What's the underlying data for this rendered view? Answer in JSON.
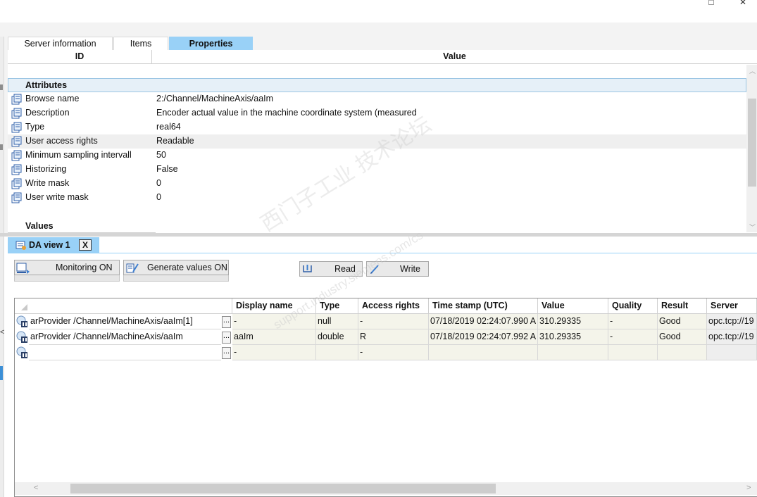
{
  "window": {
    "minimize_glyph": "□",
    "close_glyph": "✕"
  },
  "tabs": [
    {
      "label": "Server information",
      "active": false
    },
    {
      "label": "Items",
      "active": false
    },
    {
      "label": "Properties",
      "active": true
    }
  ],
  "properties": {
    "columns": {
      "id": "ID",
      "value": "Value"
    },
    "group_attributes": "Attributes",
    "rows": [
      {
        "id": "Browse name",
        "value": "2:/Channel/MachineAxis/aaIm",
        "highlighted": false
      },
      {
        "id": "Description",
        "value": "Encoder actual value in the machine coordinate system (measured",
        "highlighted": false
      },
      {
        "id": "Type",
        "value": "real64",
        "highlighted": false
      },
      {
        "id": "User access rights",
        "value": "Readable",
        "highlighted": true
      },
      {
        "id": "Minimum sampling intervall",
        "value": "50",
        "highlighted": false
      },
      {
        "id": "Historizing",
        "value": "False",
        "highlighted": false
      },
      {
        "id": "Write mask",
        "value": "0",
        "highlighted": false
      },
      {
        "id": "User write mask",
        "value": "0",
        "highlighted": false
      }
    ],
    "group_values": "Values"
  },
  "da_view": {
    "tab_label": "DA view 1",
    "close_label": "X",
    "buttons": {
      "monitoring": "Monitoring ON",
      "generate": "Generate values ON",
      "read": "Read",
      "write": "Write"
    },
    "columns": {
      "display_name": "Display name",
      "type": "Type",
      "access_rights": "Access rights",
      "timestamp": "Time stamp (UTC)",
      "value": "Value",
      "quality": "Quality",
      "result": "Result",
      "server": "Server"
    },
    "ellipsis_label": "...",
    "rows": [
      {
        "item": "arProvider /Channel/MachineAxis/aaIm[1]",
        "display_name": "-",
        "type": "null",
        "access_rights": "-",
        "timestamp": "07/18/2019 02:24:07.990 A",
        "value": "310.29335",
        "quality": "-",
        "result": "Good",
        "server": "opc.tcp://19"
      },
      {
        "item": "arProvider /Channel/MachineAxis/aaIm",
        "display_name": "aaIm",
        "type": "double",
        "access_rights": "R",
        "timestamp": "07/18/2019 02:24:07.992 A",
        "value": "310.29335",
        "quality": "-",
        "result": "Good",
        "server": "opc.tcp://19"
      },
      {
        "item": "",
        "display_name": "-",
        "type": "",
        "access_rights": "-",
        "timestamp": "",
        "value": "",
        "quality": "",
        "result": "",
        "server": ""
      }
    ]
  },
  "watermark": {
    "line1": "西门子工业  技术论坛",
    "line2": "support.industry.siemens.com/cs"
  },
  "colors": {
    "accent": "#99d1f7",
    "group_bg": "#e6f0f8",
    "cell_bg": "#f4f4ea"
  }
}
